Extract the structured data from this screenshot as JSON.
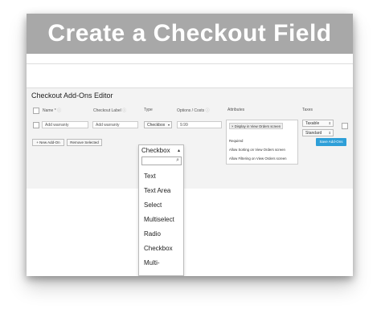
{
  "banner": {
    "title": "Create a Checkout Field"
  },
  "editor": {
    "title": "Checkout Add-Ons Editor",
    "headers": {
      "name": "Name *",
      "checkout_label": "Checkout Label",
      "type": "Type",
      "options_costs": "Options / Costs",
      "attributes": "Attributes",
      "taxes": "Taxes"
    },
    "row": {
      "name_placeholder": "Add warranty",
      "label_placeholder": "Add warranty",
      "type_value": "Checkbox",
      "cost_value": "9.99",
      "attribute_tag": "× Display in View Orders screen",
      "tax_status": "Taxable",
      "tax_class": "Standard"
    },
    "attribute_options": [
      "Required",
      "Allow Sorting on View Orders screen",
      "Allow Filtering on View Orders screen"
    ],
    "buttons": {
      "new": "+ New Add-On",
      "remove": "Remove Selected",
      "save": "Save Add-Ons"
    }
  },
  "type_dropdown": {
    "selected": "Checkbox",
    "options": [
      "Text",
      "Text Area",
      "Select",
      "Multiselect",
      "Radio",
      "Checkbox",
      "Multi-"
    ]
  }
}
